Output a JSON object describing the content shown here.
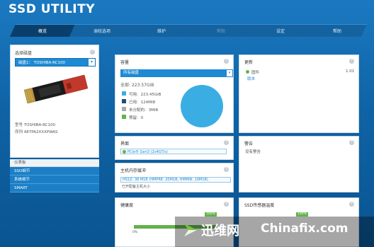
{
  "app": {
    "title": "SSD UTILITY"
  },
  "tabs": [
    {
      "label": "概览",
      "active": true
    },
    {
      "label": "调校选项"
    },
    {
      "label": "维护"
    },
    {
      "label": "帮助",
      "disabled": true,
      "display": ""
    },
    {
      "label": "设定"
    },
    {
      "label": "帮助"
    }
  ],
  "drive_panel": {
    "heading": "选择磁盘",
    "select_value": "磁盘1： TOSHIBA-RC100",
    "model_label": "型号",
    "model_value": "TOSHIBA-RC100",
    "serial_label": "序列",
    "serial_value": "487PA2XXXPWAS"
  },
  "nav": {
    "header": "仪表板",
    "items": [
      "SSD细节",
      "系统细节",
      "SMART"
    ]
  },
  "capacity": {
    "title": "容量",
    "select_value": "所有磁盘",
    "total_label": "全部:",
    "total_value": "223.57GiB",
    "legend": [
      {
        "label": "可用:",
        "value": "223.45GiB",
        "color": "#3aaee2"
      },
      {
        "label": "已用:",
        "value": "124MiB",
        "color": "#1a4f7a"
      },
      {
        "label": "未分配的:",
        "value": "3MiB",
        "color": "#a9a9a9"
      },
      {
        "label": "预留:",
        "value": "0",
        "color": "#62b34a"
      }
    ],
    "pie_color": "#3aaee2"
  },
  "update": {
    "title": "更新",
    "item_label": "固件",
    "item_value": "1.01",
    "link": "版本"
  },
  "interface": {
    "title": "界面",
    "value": "PCIe®  Gen3 (2x4GT/s)"
  },
  "alerts": {
    "title": "警告",
    "text": "没有警告"
  },
  "host_buffer": {
    "title": "主机内存缓冲",
    "value": "HS1Z:  38 M1B (HMPRE: 20M1B, HMMIN: 10M1B)",
    "note": "已开配备主机大小"
  },
  "health": {
    "title": "健康度",
    "percent": 100,
    "min_label": "0%",
    "max_label": "100%",
    "tag": "100%"
  },
  "temperature": {
    "title": "SSD传感器温度",
    "tag": "100%"
  },
  "watermark": {
    "cn": "迅维网",
    "en": "Chinafix.com"
  }
}
